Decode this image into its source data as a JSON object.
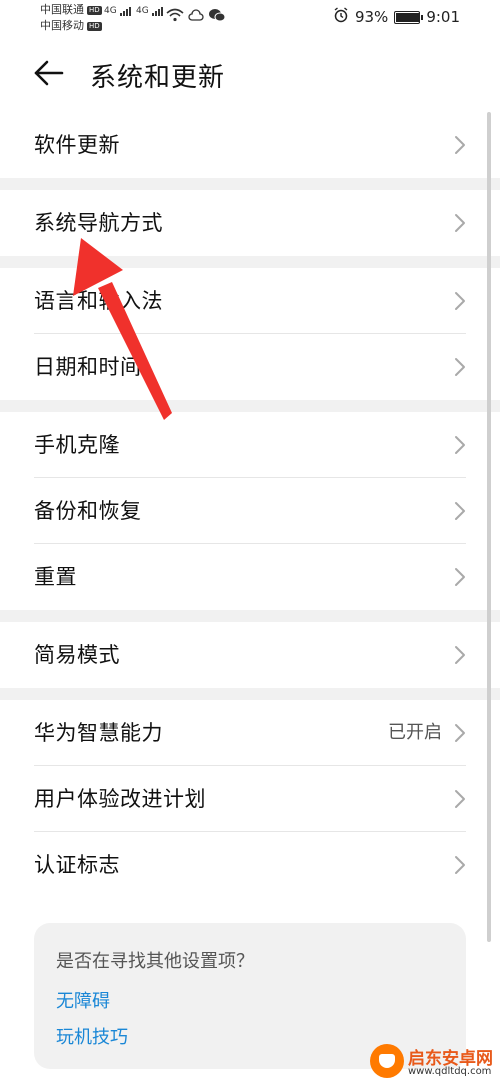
{
  "status_bar": {
    "carrier1": "中国联通",
    "carrier2": "中国移动",
    "hd": "HD",
    "network": "4G",
    "battery_pct": "93%",
    "battery_level": 0.93,
    "time": "9:01"
  },
  "header": {
    "title": "系统和更新"
  },
  "groups": [
    {
      "items": [
        {
          "label": "软件更新"
        }
      ]
    },
    {
      "items": [
        {
          "label": "系统导航方式"
        }
      ]
    },
    {
      "items": [
        {
          "label": "语言和输入法"
        },
        {
          "label": "日期和时间"
        }
      ]
    },
    {
      "items": [
        {
          "label": "手机克隆"
        },
        {
          "label": "备份和恢复"
        },
        {
          "label": "重置"
        }
      ]
    },
    {
      "items": [
        {
          "label": "简易模式"
        }
      ]
    },
    {
      "items": [
        {
          "label": "华为智慧能力",
          "value": "已开启"
        },
        {
          "label": "用户体验改进计划"
        },
        {
          "label": "认证标志"
        }
      ]
    }
  ],
  "suggestions": {
    "question": "是否在寻找其他设置项？",
    "links": [
      "无障碍",
      "玩机技巧"
    ]
  },
  "watermark": {
    "title": "启东安卓网",
    "url": "www.qdltdq.com"
  },
  "colors": {
    "link": "#1a87d6",
    "annotation_arrow": "#f0312c",
    "separator": "#f1f1f1"
  }
}
